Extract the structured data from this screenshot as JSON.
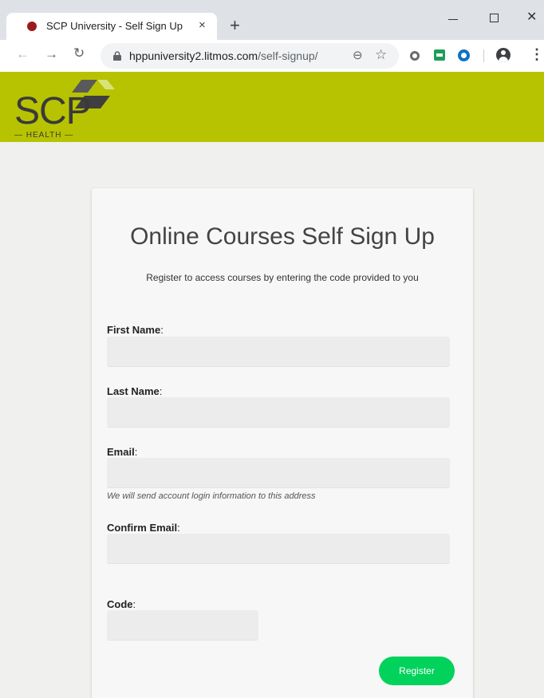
{
  "browser": {
    "tab_title": "SCP University - Self Sign Up",
    "tab_close": "×",
    "new_tab": "+",
    "url_host": "hppuniversity2.litmos.com",
    "url_path": "/self-signup/",
    "window_close": "✕"
  },
  "header": {
    "logo_text": "SCP",
    "logo_sub": "— HEALTH —",
    "background": "#b7c300"
  },
  "form": {
    "title": "Online Courses Self Sign Up",
    "subtitle": "Register to access courses by entering the code provided to you",
    "first_name_label": "First Name",
    "last_name_label": "Last Name",
    "email_label": "Email",
    "email_hint": "We will send account login information to this address",
    "confirm_email_label": "Confirm Email",
    "code_label": "Code",
    "colon": ":",
    "first_name_value": "",
    "last_name_value": "",
    "email_value": "",
    "confirm_email_value": "",
    "code_value": "",
    "register_label": "Register",
    "register_color": "#00d25b"
  },
  "icons": {
    "back": "back-arrow-icon",
    "forward": "forward-arrow-icon",
    "reload": "reload-icon",
    "lock": "lock-icon",
    "zoom": "zoom-icon",
    "star": "star-icon",
    "profile": "profile-icon",
    "menu": "menu-icon"
  }
}
